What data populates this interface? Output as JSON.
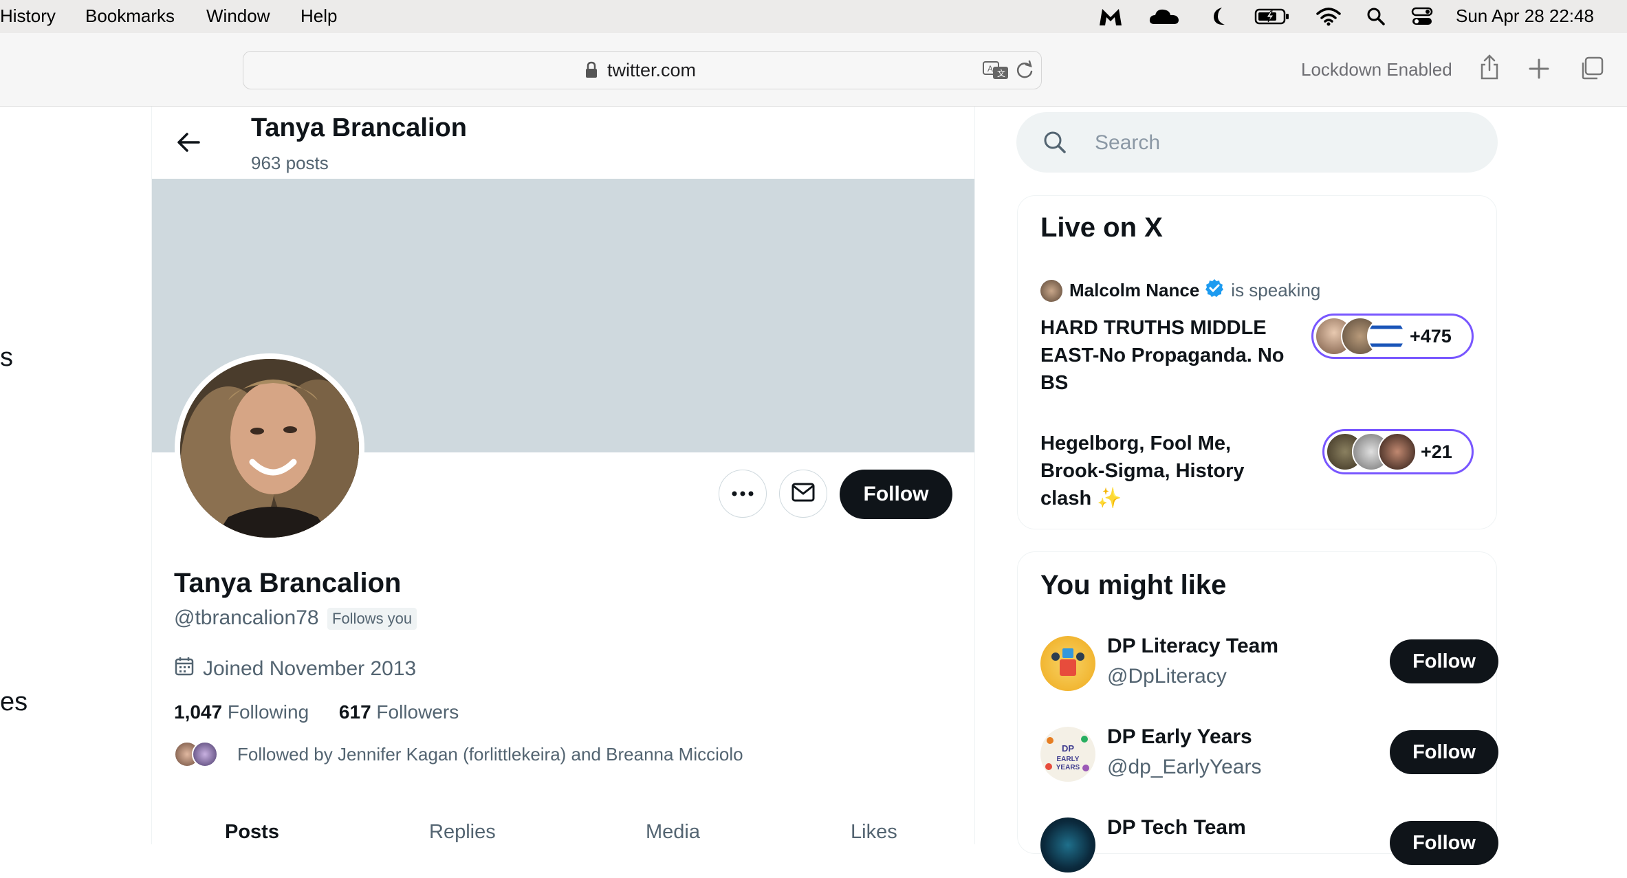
{
  "menubar": {
    "items": [
      "History",
      "Bookmarks",
      "Window",
      "Help"
    ],
    "clock": "Sun Apr 28  22:48"
  },
  "browser": {
    "url": "twitter.com",
    "lockdown_label": "Lockdown Enabled"
  },
  "left_nav_fragments": [
    "s",
    "es"
  ],
  "profile_header": {
    "name": "Tanya Brancalion",
    "posts": "963 posts"
  },
  "profile": {
    "name": "Tanya Brancalion",
    "handle": "@tbrancalion78",
    "follows_you": "Follows you",
    "joined": "Joined November 2013",
    "following_count": "1,047",
    "following_label": "Following",
    "followers_count": "617",
    "followers_label": "Followers",
    "followed_by": "Followed by Jennifer Kagan (forlittlekeira) and Breanna Micciolo",
    "follow_label": "Follow"
  },
  "tabs": [
    "Posts",
    "Replies",
    "Media",
    "Likes"
  ],
  "search": {
    "placeholder": "Search"
  },
  "live": {
    "title": "Live on X",
    "speaker": "Malcolm Nance",
    "speaking": "is speaking",
    "spaces": [
      {
        "title": "HARD TRUTHS MIDDLE EAST-No Propaganda. No BS",
        "count": "+475"
      },
      {
        "title": "Hegelborg, Fool Me, Brook-Sigma, History clash ✨",
        "count": "+21"
      }
    ]
  },
  "suggestions": {
    "title": "You might like",
    "items": [
      {
        "name": "DP Literacy Team",
        "handle": "@DpLiteracy",
        "follow": "Follow"
      },
      {
        "name": "DP Early Years",
        "handle": "@dp_EarlyYears",
        "follow": "Follow"
      },
      {
        "name": "DP Tech Team",
        "handle": "",
        "follow": "Follow"
      }
    ]
  },
  "colors": {
    "follow_button": "#0f1419",
    "banner": "#cfd9de",
    "verified": "#1d9bf0",
    "spaces_pill": "#7856ff",
    "secondary_text": "#536471"
  }
}
